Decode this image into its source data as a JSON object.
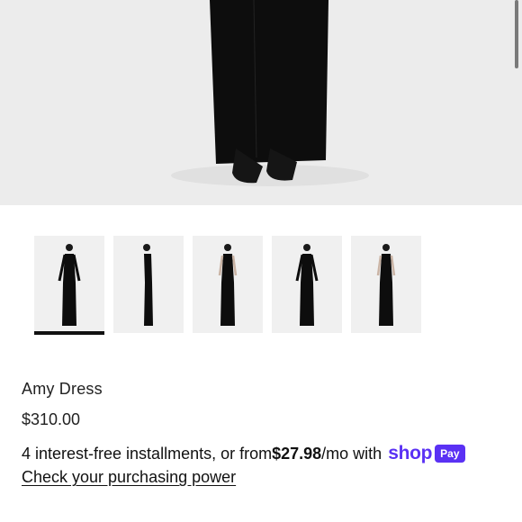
{
  "product": {
    "title": "Amy Dress",
    "price": "$310.00"
  },
  "gallery": {
    "thumbnail_count": 5,
    "active_index": 0
  },
  "financing": {
    "text_before": "4 interest-free installments, or from ",
    "amount": "$27.98",
    "text_after": "/mo with",
    "brand_word": "shop",
    "brand_badge": "Pay",
    "link_label": "Check your purchasing power"
  },
  "colors": {
    "brand": "#5a31f4",
    "dress": "#0d0d0d",
    "background": "#ededed"
  }
}
